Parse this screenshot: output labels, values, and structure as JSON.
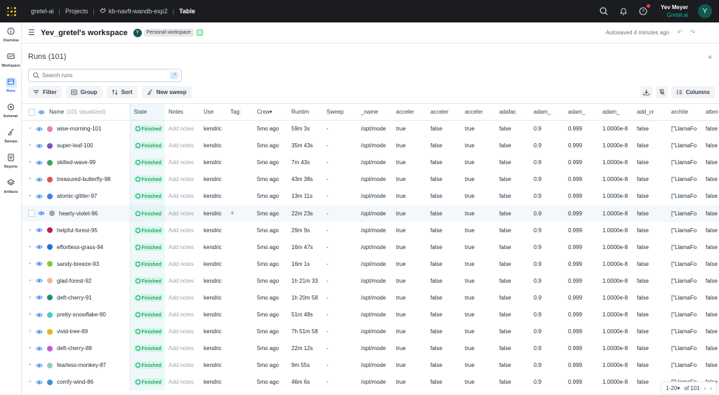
{
  "topbar": {
    "breadcrumbs": [
      "gretel-ai",
      "Projects",
      "kb-navft-wandb-exp2",
      "Table"
    ],
    "user_name": "Yev Meyer",
    "user_org": "Gretel.ai",
    "avatar_letter": "Y",
    "icons": [
      "search-icon",
      "bell-icon",
      "help-icon"
    ]
  },
  "leftnav": {
    "items": [
      {
        "label": "Overview",
        "icon": "info-icon"
      },
      {
        "label": "Workspace",
        "icon": "workspace-icon"
      },
      {
        "label": "Runs",
        "icon": "table-icon",
        "active": true
      },
      {
        "label": "Automat.",
        "icon": "automation-icon"
      },
      {
        "label": "Sweeps",
        "icon": "broom-icon"
      },
      {
        "label": "Reports",
        "icon": "report-icon"
      },
      {
        "label": "Artifacts",
        "icon": "layers-icon"
      }
    ]
  },
  "workspace": {
    "title": "Yev_gretel's workspace",
    "avatar_letter": "Y",
    "badge": "Personal workspace",
    "autosave": "Autosaved 4 minutes ago"
  },
  "runs": {
    "title": "Runs (101)",
    "search_placeholder": "Search runs",
    "regex_label": ".*",
    "toolbar": {
      "filter": "Filter",
      "group": "Group",
      "sort": "Sort",
      "new_sweep": "New sweep",
      "columns": "Columns"
    },
    "columns": {
      "name": "Name",
      "name_sub": "(101 visualized)",
      "others": [
        "State",
        "Notes",
        "Use",
        "Tag:",
        "Crea▾",
        "Runtim",
        "Sweep",
        "_name",
        "acceler",
        "acceler",
        "acceler",
        "adafac",
        "adam_",
        "adam_",
        "adam_",
        "add_cr",
        "archite",
        "atten"
      ]
    },
    "common": {
      "state": "Finished",
      "notes": "Add notes",
      "user": "kendric",
      "created": "5mo ago",
      "sweep": "-",
      "path": "/opt/mode",
      "acc1": "true",
      "acc2": "false",
      "acc3": "true",
      "adafac": "false",
      "adam1": "0.9",
      "adam2": "0.999",
      "adam3": "1.0000e-8",
      "add_cr": "false",
      "arch": "[\"LlamaFo",
      "atten": "false"
    },
    "rows": [
      {
        "name": "wise-morning-101",
        "color": "#ec7fb0",
        "runtime": "59m 3s"
      },
      {
        "name": "super-leaf-100",
        "color": "#7e4fc3",
        "runtime": "35m 43s"
      },
      {
        "name": "skilled-wave-99",
        "color": "#3aa35b",
        "runtime": "7m 43s"
      },
      {
        "name": "treasured-butterfly-98",
        "color": "#e05252",
        "runtime": "43m 38s"
      },
      {
        "name": "atomic-glitter-97",
        "color": "#3f7fe0",
        "runtime": "13m 11s"
      },
      {
        "name": "hearty-violet-96",
        "color": "#9ca3af",
        "runtime": "22m 23s"
      },
      {
        "name": "helpful-forest-95",
        "color": "#b0264f",
        "runtime": "29m 9s"
      },
      {
        "name": "effortless-grass-94",
        "color": "#1f6fd1",
        "runtime": "16m 47s"
      },
      {
        "name": "sandy-breeze-93",
        "color": "#8bc34a",
        "runtime": "16m 1s"
      },
      {
        "name": "glad-forest-92",
        "color": "#f5b49a",
        "runtime": "1h 21m 33"
      },
      {
        "name": "deft-cherry-91",
        "color": "#1f8c7c",
        "runtime": "1h 20m 58"
      },
      {
        "name": "pretty-snowflake-90",
        "color": "#4fc3d9",
        "runtime": "51m 48s"
      },
      {
        "name": "vivid-tree-89",
        "color": "#e8b12f",
        "runtime": "7h 51m 58"
      },
      {
        "name": "deft-cherry-88",
        "color": "#c459cf",
        "runtime": "22m 12s"
      },
      {
        "name": "fearless-monkey-87",
        "color": "#8fd1b6",
        "runtime": "9m 55s"
      },
      {
        "name": "comfy-wind-86",
        "color": "#3d8fd8",
        "runtime": "46m 6s"
      }
    ],
    "hover_row_plus": "+",
    "pager": {
      "range": "1-20▾",
      "of": "of 101"
    }
  }
}
